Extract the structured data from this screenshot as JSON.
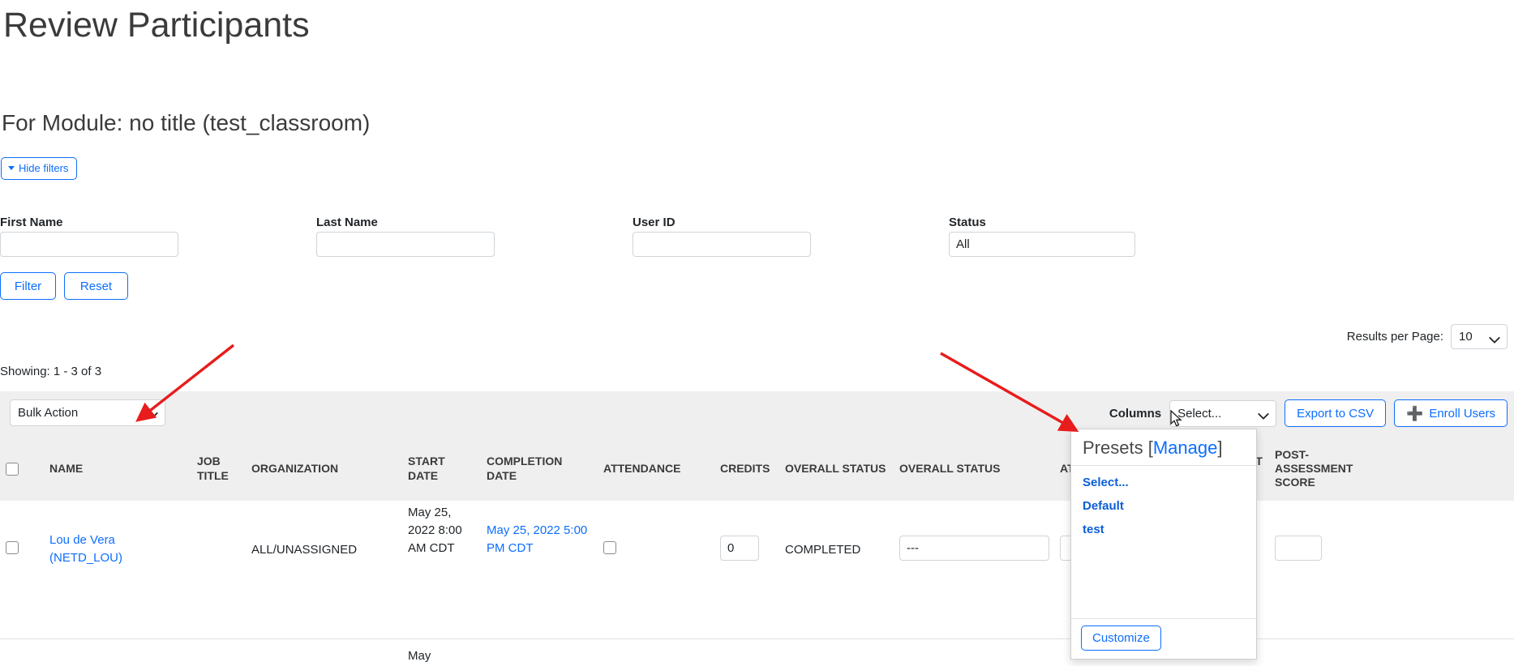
{
  "header": {
    "page_title": "Review Participants",
    "module_title": "For Module: no title (test_classroom)",
    "hide_filters_label": "Hide filters"
  },
  "filters": {
    "first_name": {
      "label": "First Name",
      "value": "",
      "placeholder": ""
    },
    "last_name": {
      "label": "Last Name",
      "value": "",
      "placeholder": ""
    },
    "user_id": {
      "label": "User ID",
      "value": "",
      "placeholder": ""
    },
    "status": {
      "label": "Status",
      "value": "All",
      "placeholder": ""
    },
    "filter_button": "Filter",
    "reset_button": "Reset"
  },
  "pagination": {
    "results_per_page_label": "Results per Page:",
    "results_per_page_value": "10",
    "showing": "Showing: 1 - 3 of 3"
  },
  "action_bar": {
    "bulk_action_value": "Bulk Action",
    "columns_label": "Columns",
    "columns_select_value": "Select...",
    "export_csv_label": "Export to CSV",
    "enroll_users_label": "Enroll Users",
    "enroll_users_icon": "plus-icon"
  },
  "presets_dropdown": {
    "title": "Presets",
    "manage_label": "Manage",
    "bracket_open": "[",
    "bracket_close": "]",
    "items": [
      {
        "label": "Select..."
      },
      {
        "label": "Default"
      },
      {
        "label": "test"
      }
    ],
    "customize_label": "Customize"
  },
  "table": {
    "columns": [
      {
        "key": "check",
        "label": ""
      },
      {
        "key": "name",
        "label": "NAME"
      },
      {
        "key": "job",
        "label": "JOB TITLE"
      },
      {
        "key": "org",
        "label": "ORGANIZATION"
      },
      {
        "key": "start",
        "label": "START DATE"
      },
      {
        "key": "comp",
        "label": "COMPLETION DATE"
      },
      {
        "key": "att",
        "label": "ATTENDANCE"
      },
      {
        "key": "cred",
        "label": "CREDITS"
      },
      {
        "key": "ovs",
        "label": "OVERALL STATUS"
      },
      {
        "key": "ovs2",
        "label": "OVERALL STATUS"
      },
      {
        "key": "att2",
        "label": "ATTENDANCE"
      },
      {
        "key": "pre",
        "label": "PRE-ASSESSMENT SCORE"
      },
      {
        "key": "post",
        "label": "POST-ASSESSMENT SCORE"
      }
    ],
    "rows": [
      {
        "name": "Lou de Vera (NETD_LOU)",
        "job_title": "",
        "organization": "ALL/UNASSIGNED",
        "start_date": "May 25, 2022 8:00 AM CDT",
        "completion_date": "May 25, 2022 5:00 PM CDT",
        "attendance_checked": false,
        "credits": "0",
        "overall_status": "COMPLETED",
        "overall_status_select": "---",
        "attendance_select": "",
        "pre_assessment_score": "",
        "post_assessment_score": ""
      },
      {
        "name": "",
        "job_title": "",
        "organization": "",
        "start_date": "May",
        "completion_date": "",
        "attendance_checked": false,
        "credits": "",
        "overall_status": "",
        "overall_status_select": "",
        "attendance_select": "",
        "pre_assessment_score": "",
        "post_assessment_score": ""
      }
    ]
  },
  "annotations": {
    "arrow_color": "#e81c1c",
    "arrow_1": "points to Bulk Action dropdown",
    "arrow_2": "points to Columns Select dropdown"
  },
  "colors": {
    "link": "#0d6efd",
    "header_bg": "#efefef",
    "text": "#212529",
    "border": "#ced4da"
  }
}
